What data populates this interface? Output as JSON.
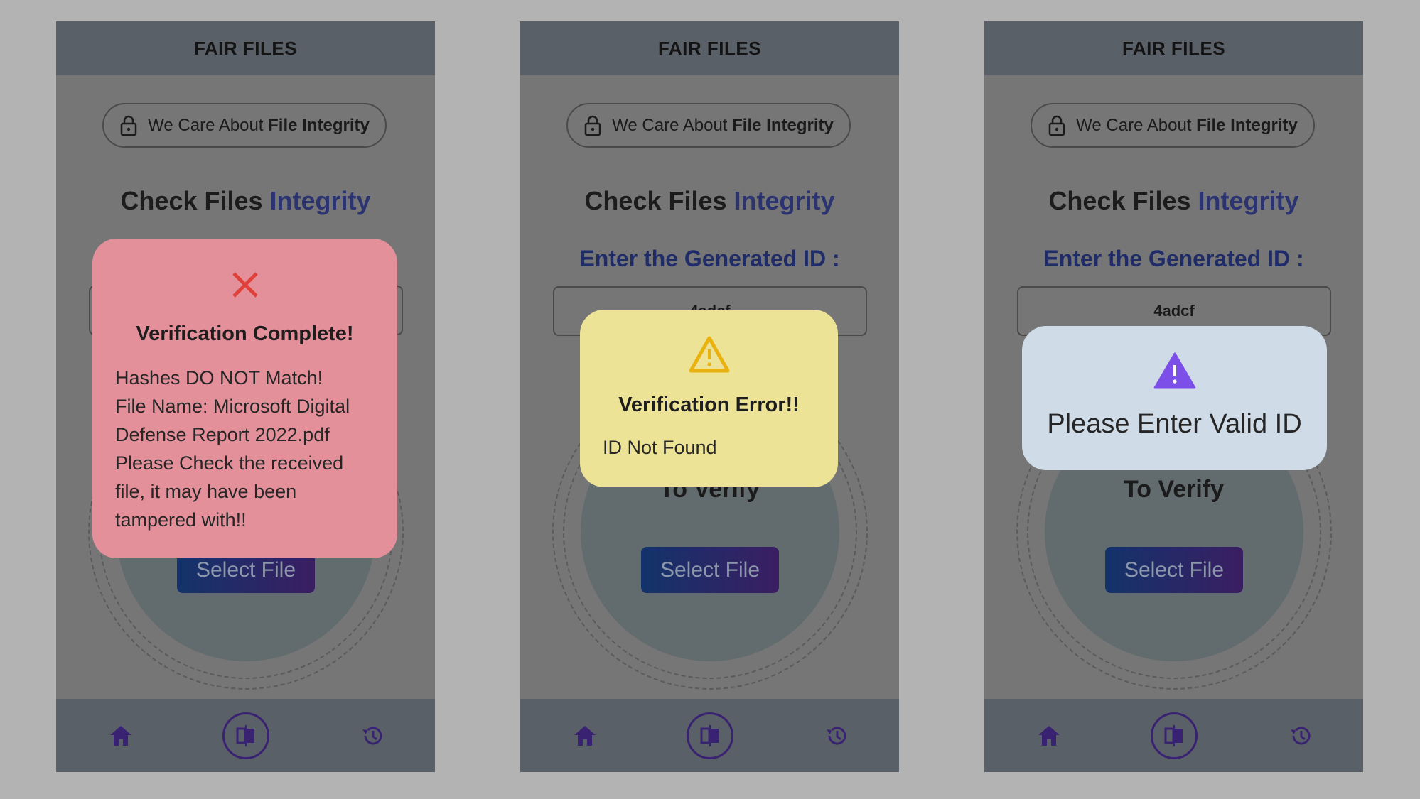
{
  "app": {
    "title": "FAIR FILES",
    "badge_prefix": "We Care About ",
    "badge_strong": "File Integrity",
    "heading_plain": "Check Files ",
    "heading_accent": "Integrity",
    "enter_id_label": "Enter the Generated ID :",
    "to_verify": "To Verify",
    "select_file": "Select File"
  },
  "screens": [
    {
      "dialog": {
        "icon": "close-x-icon",
        "title": "Verification Complete!",
        "lines": [
          "Hashes DO NOT Match!",
          "File Name: Microsoft Digital",
          "Defense Report 2022.pdf",
          "Please Check the received",
          "file, it may have been",
          "tampered with!!"
        ]
      }
    },
    {
      "id_value": "4adcf",
      "dialog": {
        "icon": "warning-triangle-icon",
        "title": "Verification Error!!",
        "lines": [
          "ID Not Found"
        ]
      }
    },
    {
      "id_value": "4adcf",
      "dialog": {
        "icon": "warning-filled-icon",
        "title": "",
        "lines": [
          "Please Enter Valid ID"
        ]
      }
    }
  ],
  "colors": {
    "error_dialog": "#e3909a",
    "warning_dialog": "#ede397",
    "info_dialog": "#d0dbe8",
    "accent": "#2b3470",
    "nav_icon": "#3a2272"
  }
}
